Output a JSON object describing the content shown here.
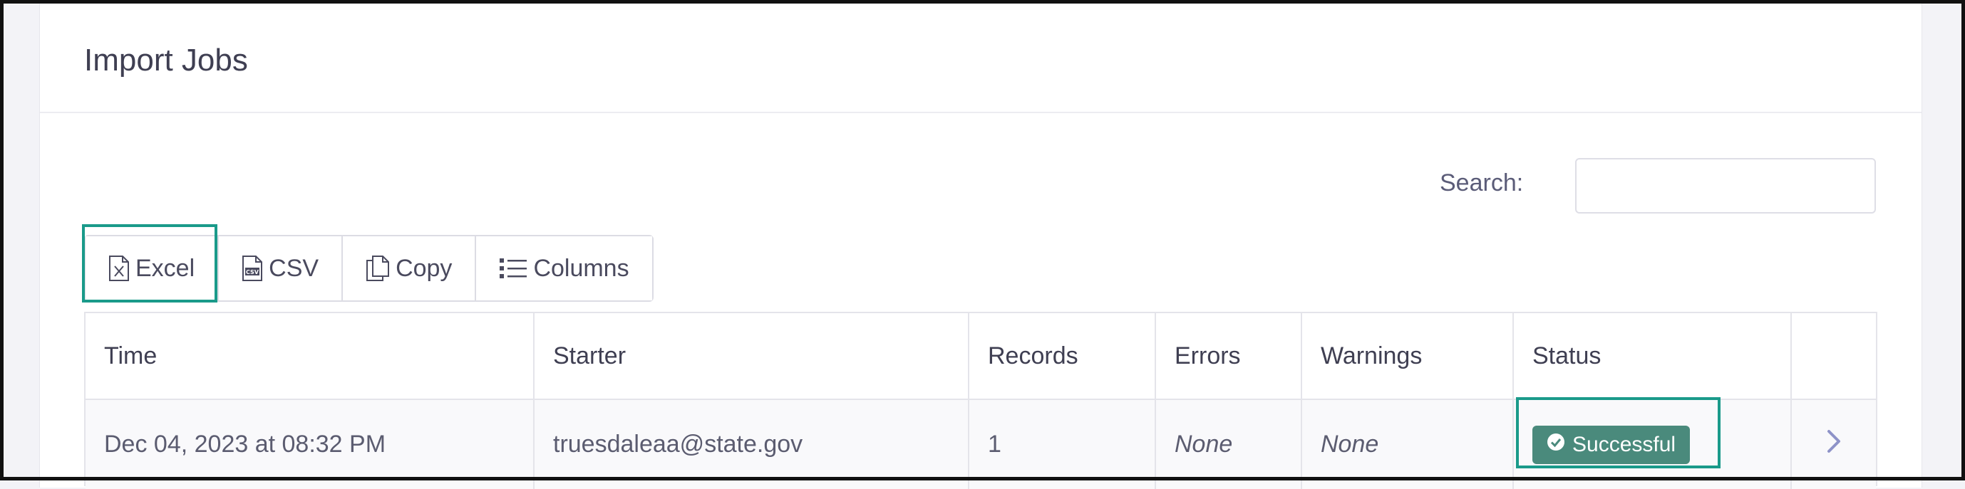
{
  "card": {
    "title": "Import Jobs"
  },
  "search": {
    "label": "Search:",
    "value": "",
    "placeholder": ""
  },
  "toolbar": {
    "buttons": [
      {
        "label": "Excel",
        "icon": "excel-file-icon"
      },
      {
        "label": "CSV",
        "icon": "csv-file-icon"
      },
      {
        "label": "Copy",
        "icon": "copy-icon"
      },
      {
        "label": "Columns",
        "icon": "list-icon"
      }
    ]
  },
  "table": {
    "columns": [
      "Time",
      "Starter",
      "Records",
      "Errors",
      "Warnings",
      "Status",
      ""
    ],
    "rows": [
      {
        "time": "Dec 04, 2023 at 08:32 PM",
        "starter": "truesdaleaa@state.gov",
        "records": "1",
        "errors": "None",
        "warnings": "None",
        "status": "Successful",
        "action_icon": "chevron-right-icon"
      }
    ]
  },
  "colors": {
    "highlight": "#1a9a8a",
    "status_success": "#4a8a7c",
    "chevron": "#8e93c8",
    "text": "#4a4a5e"
  }
}
